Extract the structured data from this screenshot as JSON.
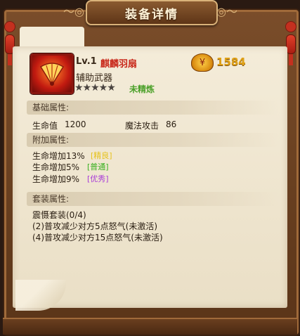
{
  "window": {
    "title": "装备详情"
  },
  "item": {
    "level": "Lv.1",
    "name": "麒麟羽扇",
    "type": "辅助武器",
    "stars": "★★★★★",
    "refine_status": "未精炼",
    "price": "1584"
  },
  "basic": {
    "header": "基础属性:",
    "hp_label": "生命值",
    "hp_value": "1200",
    "matk_label": "魔法攻击",
    "matk_value": "86"
  },
  "extra": {
    "header": "附加属性:",
    "rows": [
      {
        "text": "生命增加13%",
        "quality": "[精良]",
        "color": "#e6c21a"
      },
      {
        "text": "生命增加5%",
        "quality": "[普通]",
        "color": "#38b020"
      },
      {
        "text": "生命增加9%",
        "quality": "[优秀]",
        "color": "#a83ad8"
      }
    ]
  },
  "set": {
    "header": "套装属性:",
    "name": "震慑套装(0/4)",
    "effects": [
      "(2)普攻减少对方5点怒气(未激活)",
      "(4)普攻减少对方15点怒气(未激活)"
    ]
  },
  "colors": {
    "name_red": "#c8281a",
    "gold": "#e0a218",
    "refine_green": "#4aa028"
  },
  "icons": {
    "item": "feather-fan-icon",
    "money": "gold-ingot-icon"
  }
}
